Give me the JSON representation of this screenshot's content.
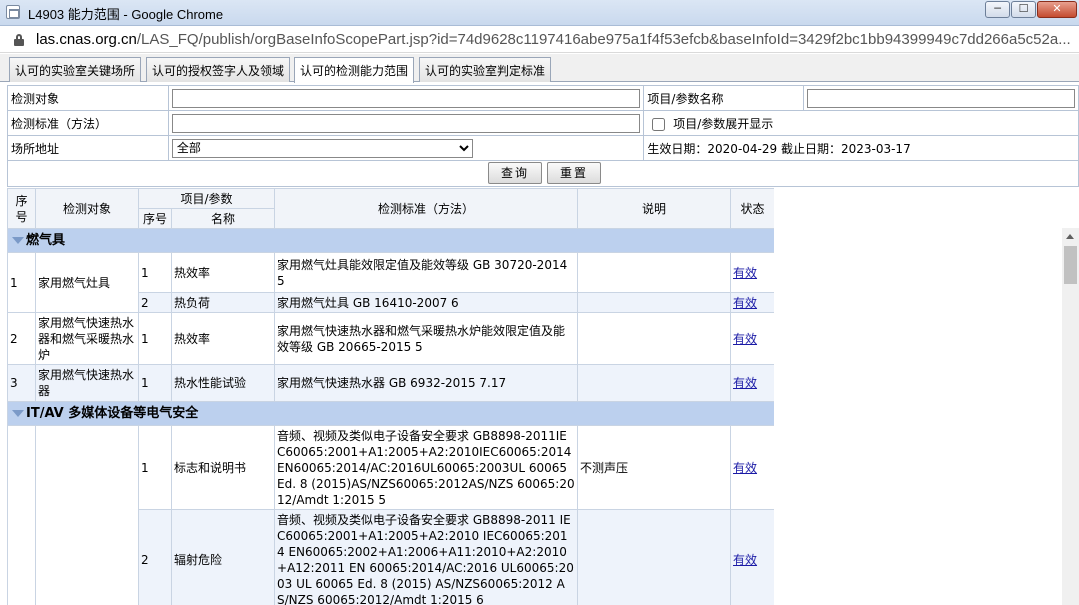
{
  "window": {
    "title": "L4903 能力范围 - Google Chrome",
    "min_label": "─",
    "max_label": "☐",
    "close_label": "✕"
  },
  "address": {
    "host": "las.cnas.org.cn",
    "path": "/LAS_FQ/publish/orgBaseInfoScopePart.jsp?id=74d9628c1197416abe975a1f4f53efcb&baseInfoId=3429f2bc1bb94399949c7dd266a5c52a..."
  },
  "tabs": [
    {
      "label": "认可的实验室关键场所"
    },
    {
      "label": "认可的授权签字人及领域"
    },
    {
      "label": "认可的检测能力范围"
    },
    {
      "label": "认可的实验室判定标准"
    }
  ],
  "filter": {
    "object_label": "检测对象",
    "object_value": "",
    "param_label": "项目/参数名称",
    "param_value": "",
    "standard_label": "检测标准（方法）",
    "standard_value": "",
    "expand_label": "项目/参数展开显示",
    "site_label": "场所地址",
    "site_selected": "全部",
    "dates_text": "生效日期：2020-04-29 截止日期：2023-03-17",
    "query_label": "查询",
    "reset_label": "重置"
  },
  "table": {
    "headers": {
      "seq": "序号",
      "object": "检测对象",
      "item_group": "项目/参数",
      "item_seq": "序号",
      "item_name": "名称",
      "standard": "检测标准（方法）",
      "note": "说明",
      "status": "状态"
    },
    "groups": [
      {
        "name": "燃气具",
        "rows": [
          {
            "seq": "1",
            "object": "家用燃气灶具",
            "item_seq": "1",
            "item_name": "热效率",
            "standard": "家用燃气灶具能效限定值及能效等级 GB 30720-2014 5",
            "note": "",
            "status": "有效"
          },
          {
            "seq": "",
            "object": "",
            "item_seq": "2",
            "item_name": "热负荷",
            "standard": "家用燃气灶具 GB 16410-2007 6",
            "note": "",
            "status": "有效"
          },
          {
            "seq": "2",
            "object": "家用燃气快速热水器和燃气采暖热水炉",
            "item_seq": "1",
            "item_name": "热效率",
            "standard": "家用燃气快速热水器和燃气采暖热水炉能效限定值及能效等级 GB 20665-2015 5",
            "note": "",
            "status": "有效"
          },
          {
            "seq": "3",
            "object": "家用燃气快速热水器",
            "item_seq": "1",
            "item_name": "热水性能试验",
            "standard": "家用燃气快速热水器 GB 6932-2015 7.17",
            "note": "",
            "status": "有效"
          }
        ]
      },
      {
        "name": "IT/AV 多媒体设备等电气安全",
        "rows": [
          {
            "seq": "",
            "object": "",
            "item_seq": "1",
            "item_name": "标志和说明书",
            "standard": "音频、视频及类似电子设备安全要求 GB8898-2011IEC60065:2001+A1:2005+A2:2010IEC60065:2014EN60065:2014/AC:2016UL60065:2003UL 60065 Ed. 8 (2015)AS/NZS60065:2012AS/NZS 60065:2012/Amdt 1:2015 5",
            "note": "不测声压",
            "status": "有效"
          },
          {
            "seq": "",
            "object": "",
            "item_seq": "2",
            "item_name": "辐射危险",
            "standard": "音频、视频及类似电子设备安全要求 GB8898-2011 IEC60065:2001+A1:2005+A2:2010 IEC60065:2014 EN60065:2002+A1:2006+A11:2010+A2:2010+A12:2011 EN 60065:2014/AC:2016 UL60065:2003 UL 60065 Ed. 8 (2015) AS/NZS60065:2012 AS/NZS 60065:2012/Amdt 1:2015 6",
            "note": "",
            "status": "有效"
          }
        ]
      }
    ]
  }
}
